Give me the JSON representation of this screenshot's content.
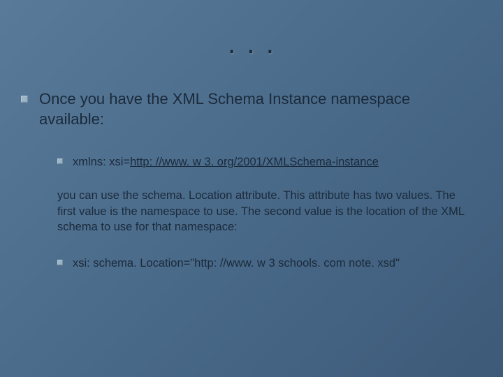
{
  "title": ". . .",
  "main": {
    "text": "Once you have the XML Schema Instance namespace available:"
  },
  "sub1": {
    "prefix": "xmlns: xsi=",
    "link": "http: //www. w 3. org/2001/XMLSchema-instance"
  },
  "paragraph": "you can use the schema. Location attribute. This attribute has two values. The first value is the namespace to use. The second value is the location of the XML schema to use for that namespace:",
  "sub2": {
    "text": "xsi: schema. Location=\"http: //www. w 3 schools. com note. xsd\""
  }
}
